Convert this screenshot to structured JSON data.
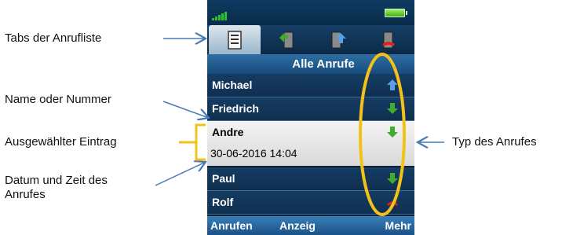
{
  "annotations": {
    "tabs": "Tabs der Anrufliste",
    "name": "Name oder Nummer",
    "selected": "Ausgewählter Eintrag",
    "datetime": "Datum und Zeit des Anrufes",
    "type": "Typ des Anrufes"
  },
  "phone": {
    "tabs": [
      {
        "icon": "list-icon",
        "active": true
      },
      {
        "icon": "incoming-call-icon",
        "active": false
      },
      {
        "icon": "outgoing-call-icon",
        "active": false
      },
      {
        "icon": "missed-call-icon",
        "active": false
      }
    ],
    "list_title": "Alle Anrufe",
    "entries": [
      {
        "name": "Michael",
        "type_icon": "outgoing-arrow-icon"
      },
      {
        "name": "Friedrich",
        "type_icon": "incoming-arrow-icon"
      },
      {
        "name": "Andre",
        "datetime": "30-06-2016 14:04",
        "type_icon": "incoming-arrow-icon",
        "selected": true
      },
      {
        "name": "Paul",
        "type_icon": "incoming-arrow-icon"
      },
      {
        "name": "Rolf",
        "type_icon": "missed-call-icon"
      }
    ],
    "softkeys": {
      "left": "Anrufen",
      "middle": "Anzeig",
      "right": "Mehr"
    }
  },
  "colors": {
    "highlight_ellipse": "#f2c21b",
    "annotation_arrow": "#4a7ab5",
    "incoming": "#3fae2a",
    "outgoing": "#5a9ee8",
    "missed": "#e02020"
  }
}
